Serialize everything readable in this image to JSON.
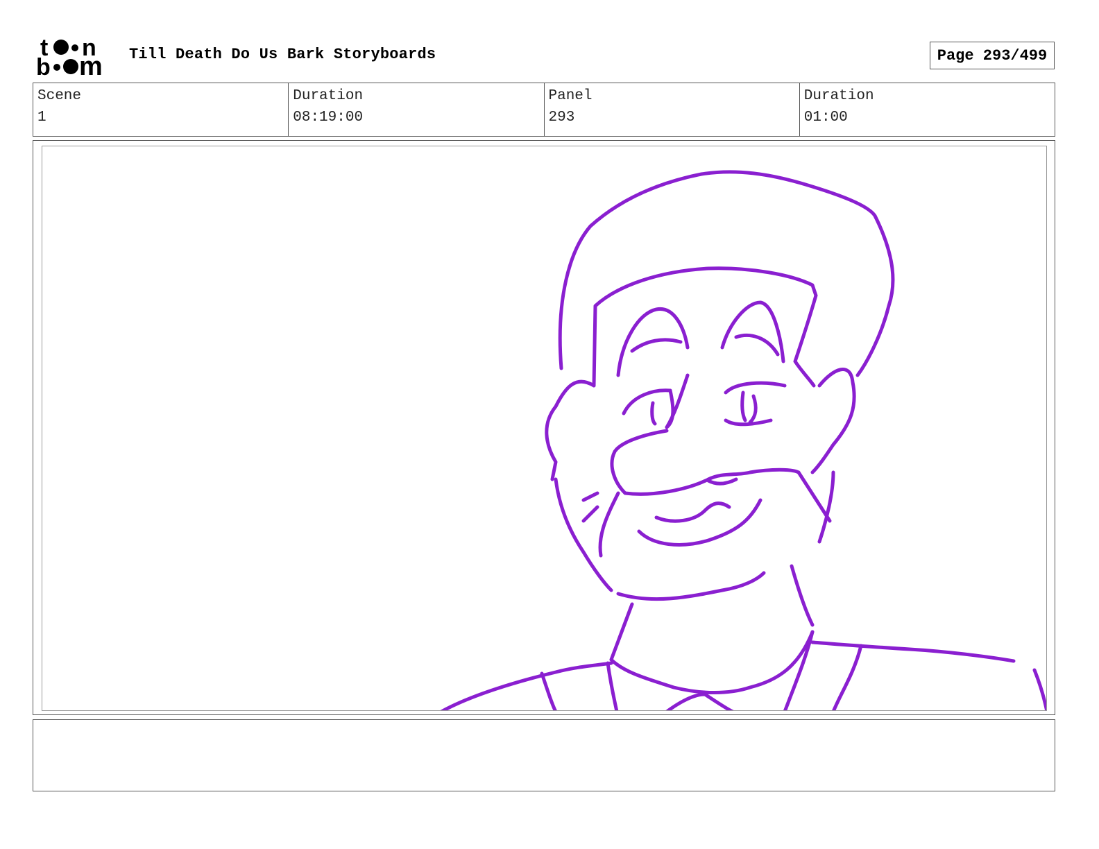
{
  "header": {
    "logo_text": "toon boom",
    "title": "Till Death Do Us Bark Storyboards",
    "page_label": "Page 293/499"
  },
  "info": {
    "scene_label": "Scene",
    "scene_value": "1",
    "scene_duration_label": "Duration",
    "scene_duration_value": "08:19:00",
    "panel_label": "Panel",
    "panel_value": "293",
    "panel_duration_label": "Duration",
    "panel_duration_value": "01:00"
  },
  "sketch": {
    "subject": "man-face-sketch",
    "stroke_color": "#8a1fd0"
  },
  "notes": {
    "text": ""
  }
}
